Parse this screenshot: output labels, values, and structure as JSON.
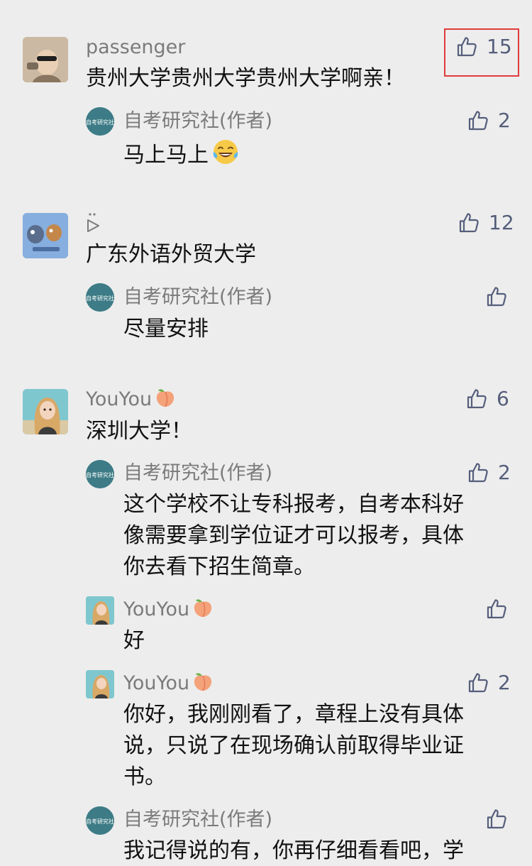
{
  "comments": [
    {
      "user": "passenger",
      "text": "贵州大学贵州大学贵州大学啊亲！",
      "likes": "15",
      "reply": {
        "user": "自考研究社(作者)",
        "text": "马上马上",
        "likes": "2"
      }
    },
    {
      "user": "",
      "text": "广东外语外贸大学",
      "likes": "12",
      "reply": {
        "user": "自考研究社(作者)",
        "text": "尽量安排",
        "likes": ""
      }
    },
    {
      "user": "YouYou",
      "text": "深圳大学！",
      "likes": "6",
      "replies": [
        {
          "user": "自考研究社(作者)",
          "lines": [
            "这个学校不让专科报考，自考本科好",
            "像需要拿到学位证才可以报考，具体",
            "你去看下招生简章。"
          ],
          "likes": "2"
        },
        {
          "user": "YouYou",
          "text": "好",
          "likes": ""
        },
        {
          "user": "YouYou",
          "lines": [
            "你好，我刚刚看了，章程上没有具体",
            "说，只说了在现场确认前取得毕业证",
            "书。"
          ],
          "likes": "2"
        },
        {
          "user": "自考研究社(作者)",
          "text": "我记得说的有，你再仔细看看吧，学",
          "likes": ""
        }
      ]
    }
  ],
  "avatar_labels": {
    "author": "自考研究社"
  },
  "colors": {
    "background": "#ededed",
    "name": "#7b7b7b",
    "like_icon": "#555e7b",
    "highlight": "#e03b3b",
    "author_avatar": "#3d7c86"
  },
  "icons": {
    "like": "thumbs-up-icon",
    "play": "play-outline-icon",
    "peach": "peach-emoji",
    "laugh": "tears-of-joy-emoji"
  }
}
